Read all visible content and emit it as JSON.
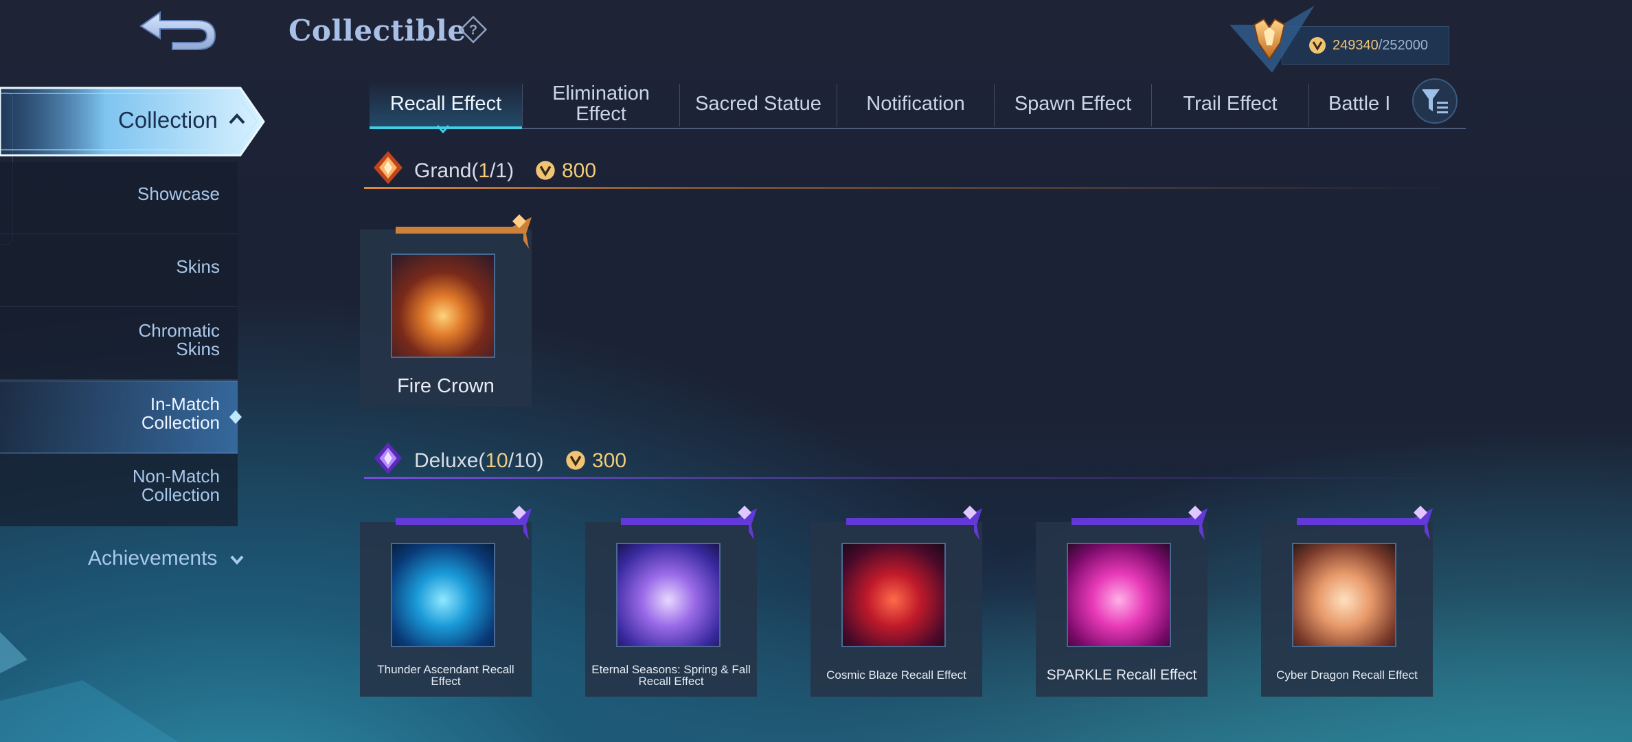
{
  "header": {
    "title": "Collectible",
    "help_symbol": "?",
    "currency_current": "249340",
    "currency_separator": "/",
    "currency_max": "252000"
  },
  "sidebar": {
    "collection_label": "Collection",
    "items": [
      {
        "label_line1": "Showcase",
        "label_line2": ""
      },
      {
        "label_line1": "Skins",
        "label_line2": ""
      },
      {
        "label_line1": "Chromatic",
        "label_line2": "Skins"
      },
      {
        "label_line1": "In-Match",
        "label_line2": "Collection"
      },
      {
        "label_line1": "Non-Match",
        "label_line2": "Collection"
      }
    ],
    "achievements_label": "Achievements"
  },
  "tabs": [
    {
      "line1": "Recall Effect",
      "line2": ""
    },
    {
      "line1": "Elimination",
      "line2": "Effect"
    },
    {
      "line1": "Sacred Statue",
      "line2": ""
    },
    {
      "line1": "Notification",
      "line2": ""
    },
    {
      "line1": "Spawn Effect",
      "line2": ""
    },
    {
      "line1": "Trail Effect",
      "line2": ""
    },
    {
      "line1": "Battle I",
      "line2": ""
    }
  ],
  "sections": {
    "grand": {
      "name": "Grand(",
      "owned": "1",
      "sep": "/",
      "total": "1",
      "close": ")",
      "price": "800",
      "items": [
        {
          "name": "Fire Crown"
        }
      ]
    },
    "deluxe": {
      "name": "Deluxe(",
      "owned": "10",
      "sep": "/",
      "total": "10",
      "close": ")",
      "price": "300",
      "items": [
        {
          "line1": "Thunder Ascendant Recall",
          "line2": "Effect"
        },
        {
          "line1": "Eternal Seasons: Spring & Fall",
          "line2": "Recall Effect"
        },
        {
          "line1": "Cosmic Blaze Recall Effect",
          "line2": ""
        },
        {
          "line1": "SPARKLE Recall Effect",
          "line2": ""
        },
        {
          "line1": "Cyber Dragon Recall Effect",
          "line2": ""
        }
      ]
    }
  },
  "colors": {
    "accent_cyan": "#3fd0e8",
    "gold": "#f3cc78",
    "grand_orange": "#e08a3a",
    "deluxe_purple": "#7a4ae0"
  },
  "icons": [
    "back-arrow-icon",
    "help-icon",
    "rank-emblem-icon",
    "coin-icon",
    "chevron-up-icon",
    "chevron-down-icon",
    "filter-icon",
    "grand-tier-icon",
    "deluxe-tier-icon"
  ]
}
